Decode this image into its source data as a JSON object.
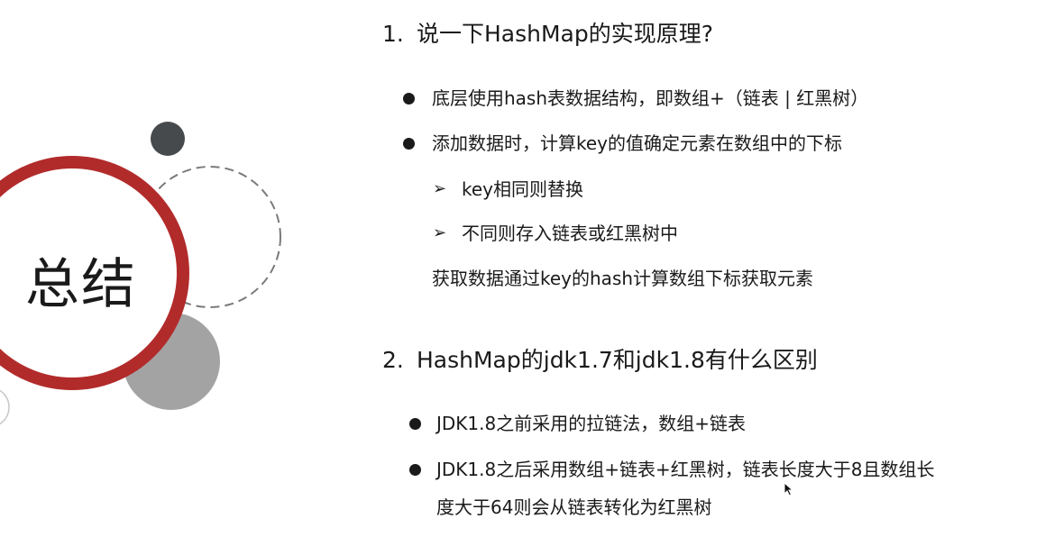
{
  "title_label": "总结",
  "section1": {
    "number": "1.",
    "heading": "说一下HashMap的实现原理?",
    "bullet1": "底层使用hash表数据结构，即数组+（链表 | 红黑树）",
    "bullet2": "添加数据时，计算key的值确定元素在数组中的下标",
    "sub1": "key相同则替换",
    "sub2": "不同则存入链表或红黑树中",
    "note": "获取数据通过key的hash计算数组下标获取元素"
  },
  "section2": {
    "number": "2.",
    "heading": "HashMap的jdk1.7和jdk1.8有什么区别",
    "bullet1": "JDK1.8之前采用的拉链法，数组+链表",
    "bullet2_line1": "JDK1.8之后采用数组+链表+红黑树，链表长度大于8且数组长",
    "bullet2_line2": "度大于64则会从链表转化为红黑树"
  },
  "colors": {
    "ring_red": "#b22b2b",
    "dark_circle": "#474a4d",
    "gray_circle": "#a3a3a3",
    "dashed_circle": "#7a7a7a",
    "text": "#1a1a1a"
  },
  "icons": {
    "bullet": "filled-circle",
    "sub_bullet": "arrowhead-right",
    "cursor": "mouse-pointer"
  }
}
